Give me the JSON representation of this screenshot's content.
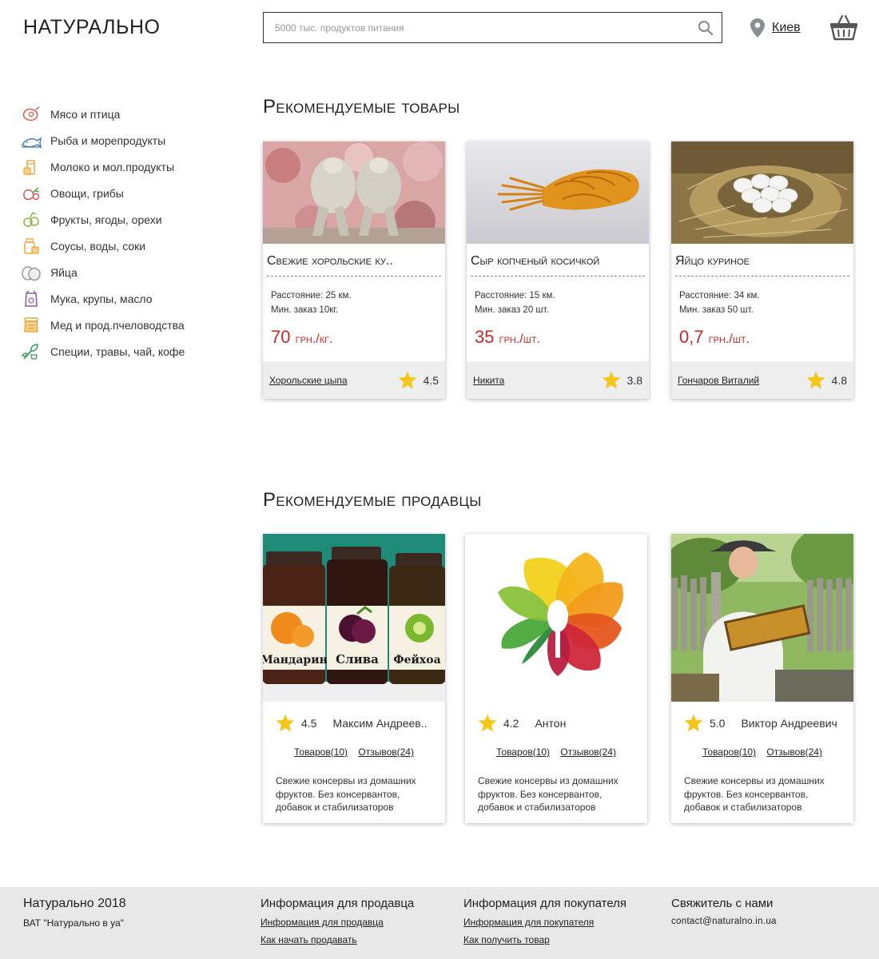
{
  "header": {
    "logo": "НАТУРАЛЬНО",
    "search_placeholder": "5000 тыс. продуктов питания",
    "city": "Киев"
  },
  "sidebar": {
    "items": [
      {
        "label": "Мясо и птица",
        "icon": "meat-icon",
        "color": "#e05a4a"
      },
      {
        "label": "Рыба и морепродукты",
        "icon": "fish-icon",
        "color": "#4a7fa8"
      },
      {
        "label": "Молоко и мол.продукты",
        "icon": "milk-icon",
        "color": "#e7a83a"
      },
      {
        "label": "Овощи, грибы",
        "icon": "vegetables-icon",
        "color": "#d9534f"
      },
      {
        "label": "Фрукты, ягоды, орехи",
        "icon": "fruits-icon",
        "color": "#8ab84a"
      },
      {
        "label": "Соусы, воды, соки",
        "icon": "sauce-icon",
        "color": "#e7a83a"
      },
      {
        "label": "Яйца",
        "icon": "eggs-icon",
        "color": "#999999"
      },
      {
        "label": "Мука, крупы, масло",
        "icon": "flour-icon",
        "color": "#8a5aa8"
      },
      {
        "label": "Мед и прод.пчеловодства",
        "icon": "honey-icon",
        "color": "#e7a83a"
      },
      {
        "label": "Специи, травы, чай, кофе",
        "icon": "herbs-icon",
        "color": "#3a9a5a"
      }
    ]
  },
  "products_section": {
    "title": "Рекомендуемые товары",
    "items": [
      {
        "title": "Свежие хорольские ку..",
        "distance": "Расстояние: 25 км.",
        "min_order": "Мин. заказ 10кг.",
        "price": "70",
        "unit": "грн./кг.",
        "seller": "Хорольские цыпа",
        "rating": "4.5"
      },
      {
        "title": "Сыр копченый косичкой",
        "distance": "Расстояние: 15 км.",
        "min_order": "Мин. заказ 20 шт.",
        "price": "35",
        "unit": "грн./шт.",
        "seller": "Никита",
        "rating": "3.8"
      },
      {
        "title": "Яйцо куриное",
        "distance": "Расстояние: 34 км.",
        "min_order": "Мин. заказ 50 шт.",
        "price": "0,7",
        "unit": "грн./шт.",
        "seller": "Гончаров Виталий",
        "rating": "4.8"
      }
    ]
  },
  "sellers_section": {
    "title": "Рекомендуемые продавцы",
    "items": [
      {
        "rating": "4.5",
        "name": "Максим Андреев..",
        "goods": "Товаров(10)",
        "reviews": "Отзывов(24)",
        "desc": "Свежие консервы из домашних фруктов. Без консервантов, добавок и стабилизаторов",
        "jar_labels": [
          "Мандарин",
          "Слива",
          "Фейхоа"
        ]
      },
      {
        "rating": "4.2",
        "name": "Антон",
        "goods": "Товаров(10)",
        "reviews": "Отзывов(24)",
        "desc": "Свежие консервы из домашних фруктов. Без консервантов, добавок и стабилизаторов"
      },
      {
        "rating": "5.0",
        "name": "Виктор Андреевич",
        "goods": "Товаров(10)",
        "reviews": "Отзывов(24)",
        "desc": "Свежие консервы из домашних фруктов. Без консервантов, добавок и стабилизаторов"
      }
    ]
  },
  "footer": {
    "brand": "Натурально 2018",
    "brand_sub": "ВАТ \"Натурально в уа\"",
    "seller_info_title": "Информация для продавца",
    "seller_info_link": "Информация для продавца",
    "seller_start_link": "Как начать продавать",
    "buyer_info_title": "Информация для покупателя",
    "buyer_info_link": "Информация для покупателя",
    "buyer_get_link": "Как получить товар",
    "contact_title": "Свяжитель с нами",
    "contact_email": "contact@naturalno.in.ua"
  },
  "colors": {
    "price": "#c62828",
    "star": "#f5c518",
    "footer_bg": "#e8e8e8"
  }
}
